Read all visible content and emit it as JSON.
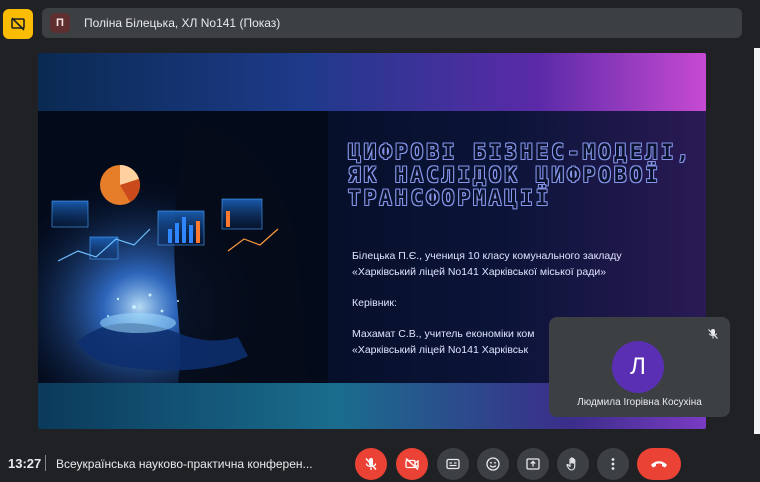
{
  "header": {
    "presenter_initial": "П",
    "presenter_label": "Поліна Білецька, ХЛ No141 (Показ)"
  },
  "slide": {
    "title_line_1": "ЦИФРОВІ БІЗНЕС-МОДЕЛІ,",
    "title_line_2": "ЯК НАСЛІДОК ЦИФРОВОЇ",
    "title_line_3": "ТРАНСФОРМАЦІЇ",
    "author_line_1": "Білецька П.Є., учениця 10 класу комунального закладу",
    "author_line_2": "«Харківський ліцей No141 Харківської міської ради»",
    "supervisor_heading": "Керівник:",
    "supervisor_line_1": "Махамат С.В., учитель економіки ком",
    "supervisor_line_2": "«Харківський ліцей No141 Харківськ"
  },
  "participant": {
    "initial": "Л",
    "name": "Людмила Ігорівна Косухіна",
    "avatar_color": "#5b2fb4"
  },
  "footer": {
    "time": "13:27",
    "meeting_title": "Всеукраїнська науково-практична конферен...",
    "controls": [
      "mic-off",
      "camera-off",
      "captions",
      "reactions",
      "present",
      "raise-hand",
      "more-options",
      "leave-call"
    ]
  },
  "colors": {
    "accent_yellow": "#fbbc04",
    "danger_red": "#ea4335",
    "surface": "#3c4043",
    "background": "#202124"
  }
}
